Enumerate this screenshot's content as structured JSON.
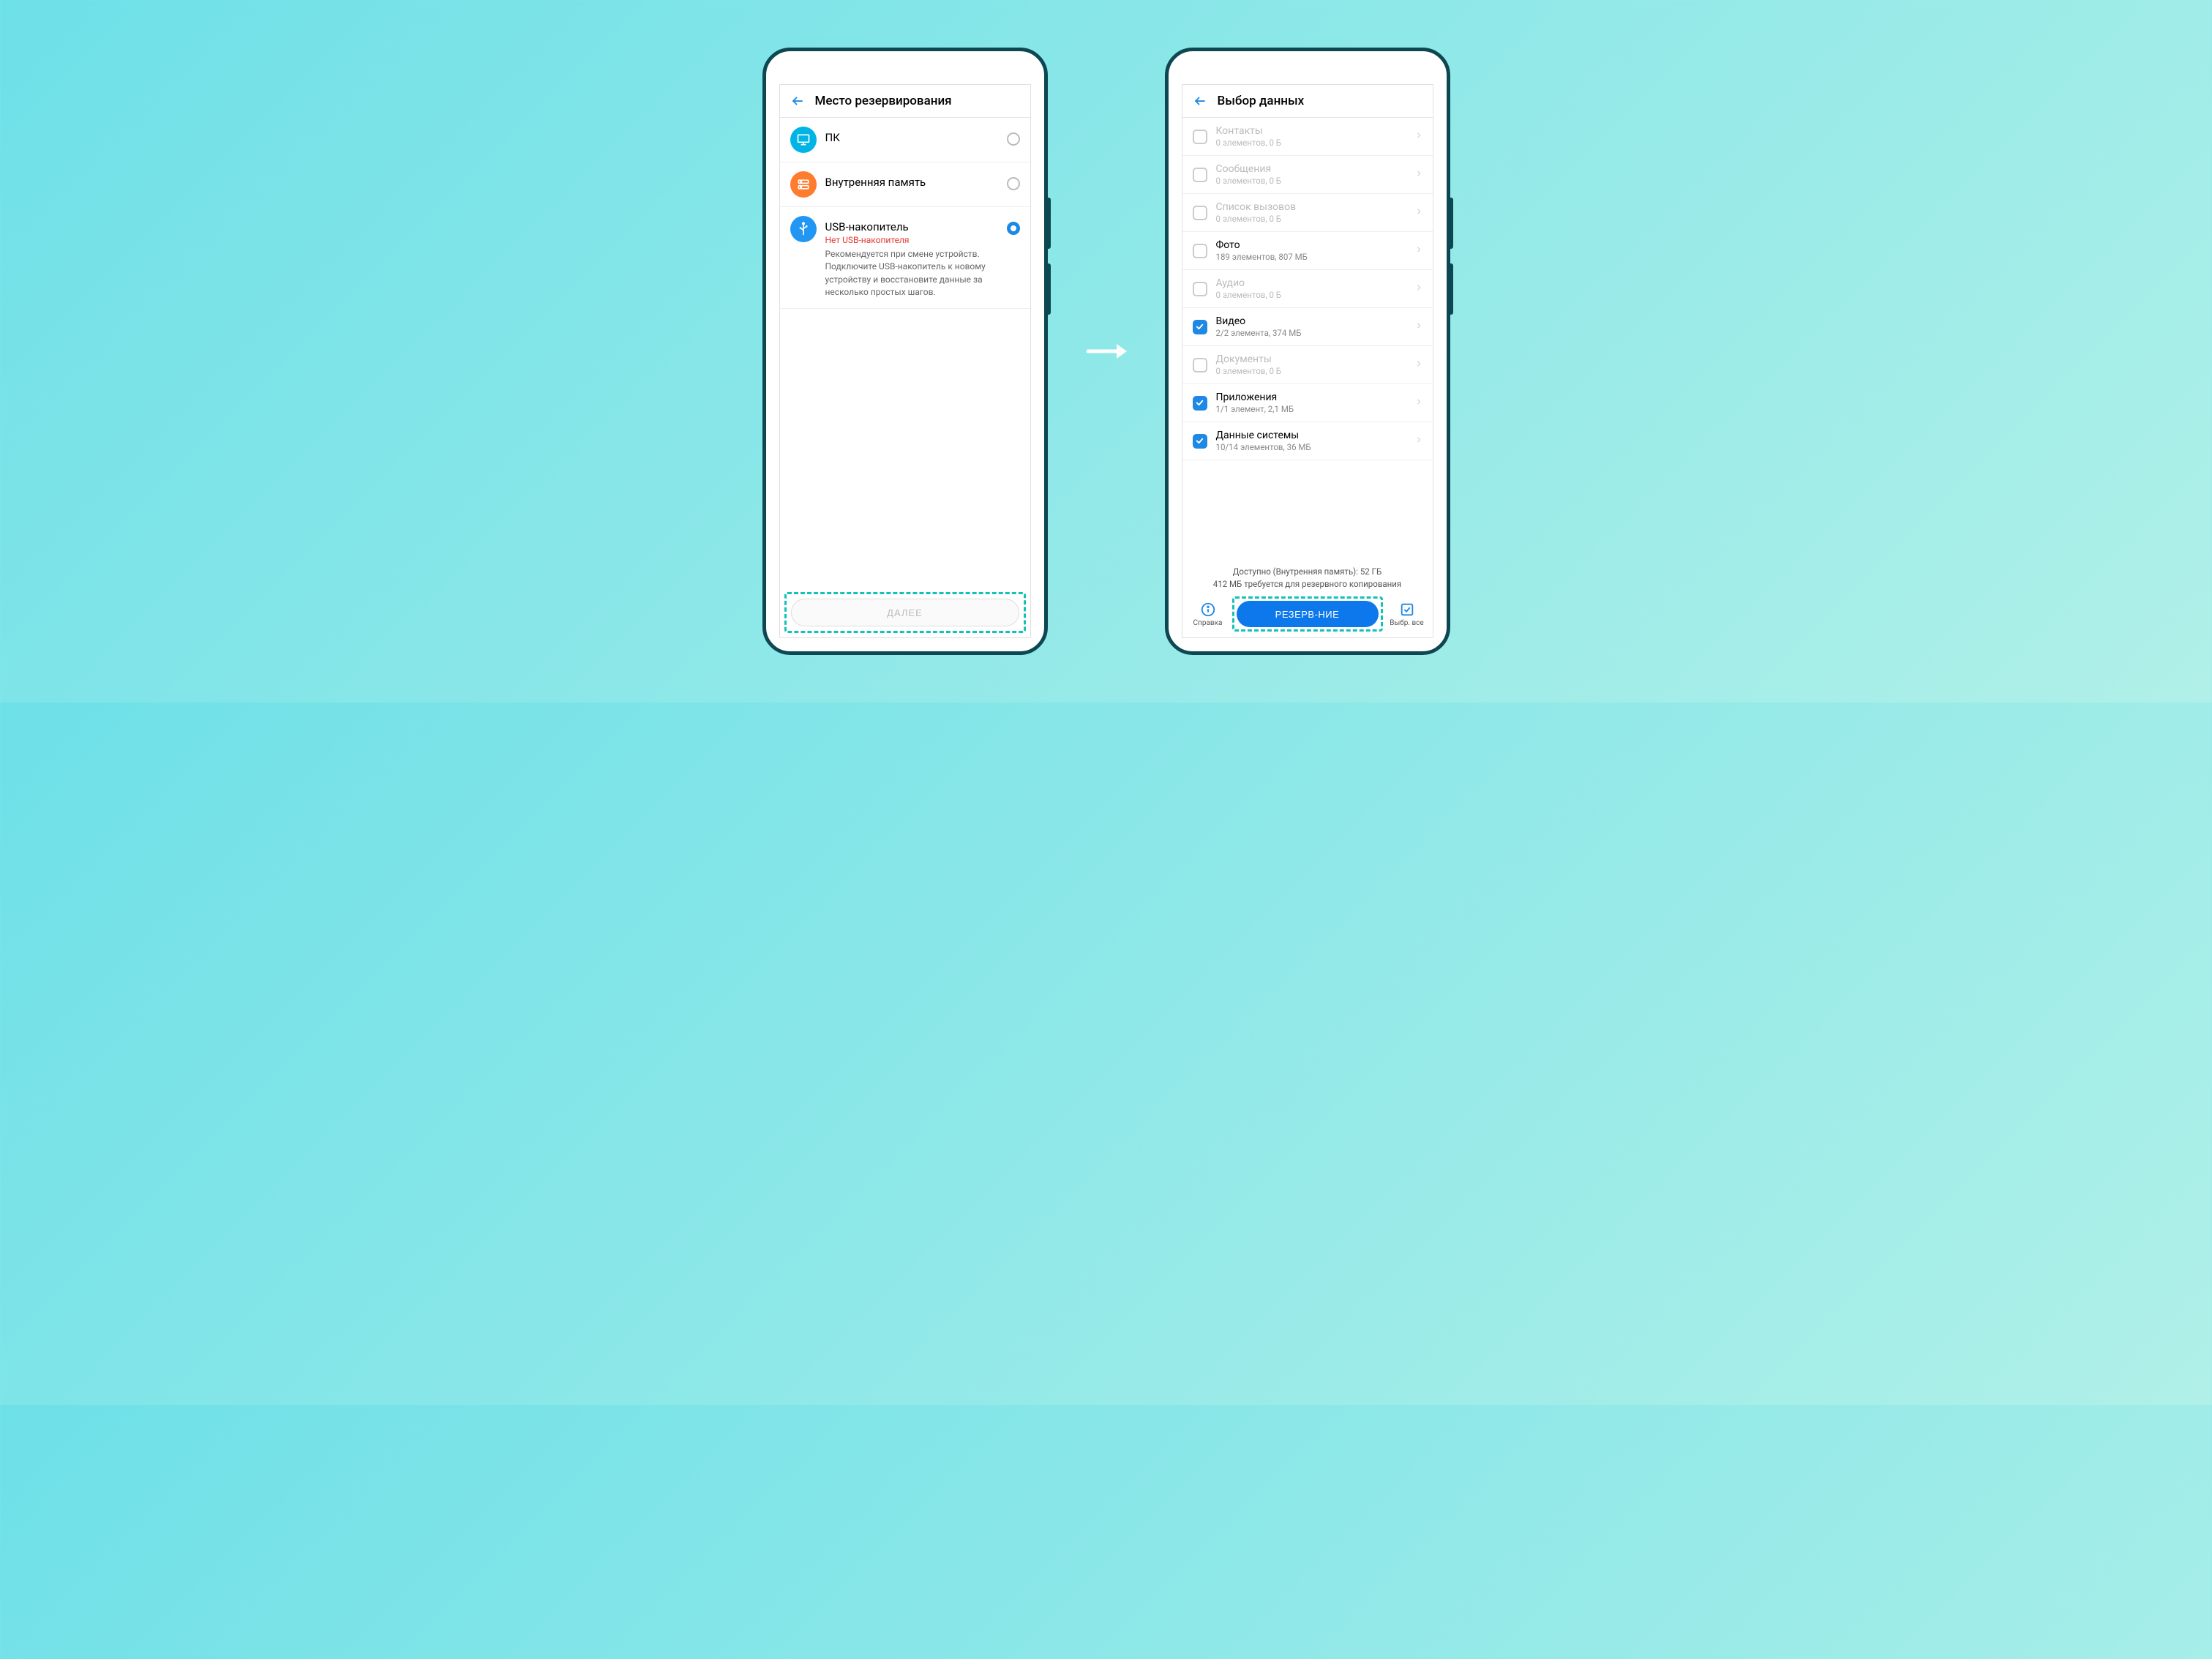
{
  "screen1": {
    "title": "Место резервирования",
    "locations": [
      {
        "id": "pc",
        "label": "ПК",
        "selected": false
      },
      {
        "id": "internal",
        "label": "Внутренняя память",
        "selected": false
      },
      {
        "id": "usb",
        "label": "USB-накопитель",
        "error": "Нет USB-накопителя",
        "desc": "Рекомендуется при смене устройств. Подключите USB-накопитель к новому устройству и восстановите данные за несколько простых шагов.",
        "selected": true
      }
    ],
    "next_label": "ДАЛЕЕ"
  },
  "screen2": {
    "title": "Выбор данных",
    "items": [
      {
        "label": "Контакты",
        "sub": "0 элементов, 0 Б",
        "checked": false,
        "disabled": true
      },
      {
        "label": "Сообщения",
        "sub": "0 элементов, 0 Б",
        "checked": false,
        "disabled": true
      },
      {
        "label": "Список вызовов",
        "sub": "0 элементов, 0 Б",
        "checked": false,
        "disabled": true
      },
      {
        "label": "Фото",
        "sub": "189 элементов, 807 МБ",
        "checked": false,
        "disabled": false
      },
      {
        "label": "Аудио",
        "sub": "0 элементов, 0 Б",
        "checked": false,
        "disabled": true
      },
      {
        "label": "Видео",
        "sub": "2/2 элемента, 374 МБ",
        "checked": true,
        "disabled": false
      },
      {
        "label": "Документы",
        "sub": "0 элементов, 0 Б",
        "checked": false,
        "disabled": true
      },
      {
        "label": "Приложения",
        "sub": "1/1 элемент, 2,1 МБ",
        "checked": true,
        "disabled": false
      },
      {
        "label": "Данные системы",
        "sub": "10/14 элементов, 36 МБ",
        "checked": true,
        "disabled": false
      }
    ],
    "footer_line1": "Доступно (Внутренняя память): 52 ГБ",
    "footer_line2": "412 МБ требуется для резервного копирования",
    "help_label": "Справка",
    "backup_label": "РЕЗЕРВ-НИЕ",
    "select_all_label": "Выбр. все"
  }
}
